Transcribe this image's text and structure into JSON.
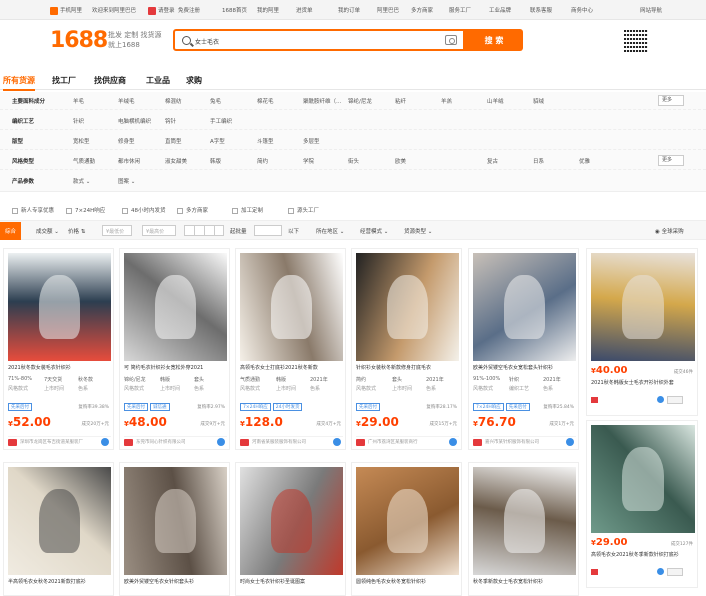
{
  "topbar": {
    "items": [
      "手机阿里",
      "欢迎来到阿里巴巴",
      "请登录",
      "免费注册",
      "1688首页",
      "我的阿里",
      "进货单",
      "收藏夹",
      "我的订单",
      "阿里巴巴",
      "多方商家",
      "服务工厂",
      "工业品牌",
      "联系客服",
      "商务中心",
      "网站导航"
    ]
  },
  "header": {
    "logo": "1688",
    "slogan": "批发 定制 找货源 就上1688",
    "search_value": "女士毛衣",
    "search_btn": "搜 索"
  },
  "tabs": [
    "所有货源",
    "找工厂",
    "找供应商",
    "工业品",
    "求购"
  ],
  "filters": {
    "rows": [
      {
        "label": "主要面料成分",
        "options": [
          "羊毛",
          "羊绒毛",
          "棉混纺",
          "兔毛",
          "棉花毛",
          "聚酰胺纤维（…",
          "锦纶/尼龙",
          "粘纤",
          "羊羔",
          "山羊绒",
          "貂绒"
        ],
        "more": "更多"
      },
      {
        "label": "编织工艺",
        "options": [
          "针织",
          "电脑横机编织",
          "钩针",
          "手工编织"
        ]
      },
      {
        "label": "版型",
        "options": [
          "宽松型",
          "修身型",
          "直筒型",
          "A字型",
          "斗篷型",
          "多层型"
        ]
      },
      {
        "label": "风格类型",
        "options": [
          "气质通勤",
          "都市休闲",
          "淑女甜美",
          "韩版",
          "简约",
          "学院",
          "街头",
          "欧美",
          "复古",
          "日系",
          "优雅"
        ],
        "more": "更多"
      },
      {
        "label": "产品参数",
        "options": [
          "款式",
          "图案"
        ]
      }
    ]
  },
  "checks": [
    "新人专享优惠",
    "7×24H响应",
    "48小时内发货",
    "多方商家",
    "加工定制",
    "源头工厂"
  ],
  "sortbar": {
    "items": [
      "综合",
      "成交额",
      "价格",
      "¥最低价",
      "¥最高价",
      "起批量",
      "以下",
      "所在地区",
      "经营模式",
      "货源类型"
    ],
    "right": "全球采购"
  },
  "products": [
    {
      "title": "2021秋冬款女装毛衣针织衫",
      "attrs": [
        "71%-80%",
        "7天交货",
        "秋冬款",
        "风格款式",
        "上市时间",
        "色系"
      ],
      "tags": [
        "先采后付"
      ],
      "repurchase": "复购率39.38%",
      "price": "52.00",
      "deals": "成交20万+元",
      "supplier": "深圳市龙岗区布吉街道某服装厂",
      "colors": [
        "#e74c3c",
        "#2c3e50",
        "#ecf0f1"
      ]
    },
    {
      "title": "可 简约毛衣针织衫女宽松外穿2021",
      "attrs": [
        "锦纶/尼龙",
        "韩版",
        "套头",
        "风格款式",
        "上市时间",
        "色系"
      ],
      "tags": [
        "先采后付",
        "诚信通"
      ],
      "repurchase": "复购率2.97%",
      "price": "48.00",
      "deals": "成交9万+元",
      "supplier": "东莞市同心针织有限公司",
      "colors": [
        "#d8d8d8",
        "#6d6d6d",
        "#fafafa"
      ]
    },
    {
      "title": "高领毛衣女士打底衫2021秋冬新款",
      "attrs": [
        "气质通勤",
        "韩版",
        "2021年",
        "风格款式",
        "上市时间",
        "色系"
      ],
      "tags": [
        "7×24H响应",
        "24小时发货"
      ],
      "repurchase": "",
      "price": "128.0",
      "deals": "成交4万+元",
      "supplier": "河南省某服装服饰有限公司",
      "colors": [
        "#f5f0e8",
        "#8a7a6a",
        "#ffffff"
      ]
    },
    {
      "title": "针织衫女装秋冬新款修身打底毛衣",
      "attrs": [
        "简约",
        "套头",
        "2021年",
        "风格款式",
        "上市时间",
        "色系"
      ],
      "tags": [
        "先采后付"
      ],
      "repurchase": "复购率28.17%",
      "price": "29.00",
      "deals": "成交15万+元",
      "supplier": "广州市荔湾区某服装商行",
      "colors": [
        "#222222",
        "#c49a6c",
        "#f4f1ea"
      ]
    },
    {
      "title": "欧美外贸镂空毛衣女宽松套头针织衫",
      "attrs": [
        "91%-100%",
        "针织",
        "2021年",
        "风格款式",
        "编织工艺",
        "色系"
      ],
      "tags": [
        "7×24H响应",
        "先采后付"
      ],
      "repurchase": "复购率25.84%",
      "price": "76.70",
      "deals": "成交1万+元",
      "supplier": "嘉兴市某针织服饰有限公司",
      "colors": [
        "#c8c0b8",
        "#5a6e88",
        "#eeeeee"
      ]
    },
    {
      "title": "2021秋冬韩版女士毛衣开衫针织外套",
      "attrs": [],
      "tags": [],
      "repurchase": "",
      "price": "40.00",
      "deals": "成交46件",
      "supplier": "",
      "colors": [
        "#3b4a6b",
        "#d4a84b",
        "#e8e2dc"
      ]
    },
    {
      "title": "半高领毛衣女秋冬2021新款打底衫",
      "colors": [
        "#f0ebe1",
        "#e0d8c8",
        "#4a4a4a"
      ]
    },
    {
      "title": "欧美外贸镂空毛衣女针织套头衫",
      "colors": [
        "#9a8e82",
        "#5c5046",
        "#d8d0c6"
      ]
    },
    {
      "title": "时尚女士毛衣针织衫圣诞图案",
      "colors": [
        "#e0e0e0",
        "#7a7a7a",
        "#c0392b"
      ]
    },
    {
      "title": "圆领纯色毛衣女秋冬宽松针织衫",
      "colors": [
        "#c58a55",
        "#8a5a30",
        "#f1e3d3"
      ]
    },
    {
      "title": "秋冬季新款女士毛衣宽松针织衫",
      "colors": [
        "#d8d8d8",
        "#6b5b4a",
        "#f4f4f4"
      ]
    },
    {
      "title": "高领毛衣女2021秋冬季新款针织打底衫",
      "price": "29.00",
      "deals": "成交127件",
      "colors": [
        "#6f9a8a",
        "#3a5a50",
        "#d9e6e0"
      ]
    }
  ]
}
